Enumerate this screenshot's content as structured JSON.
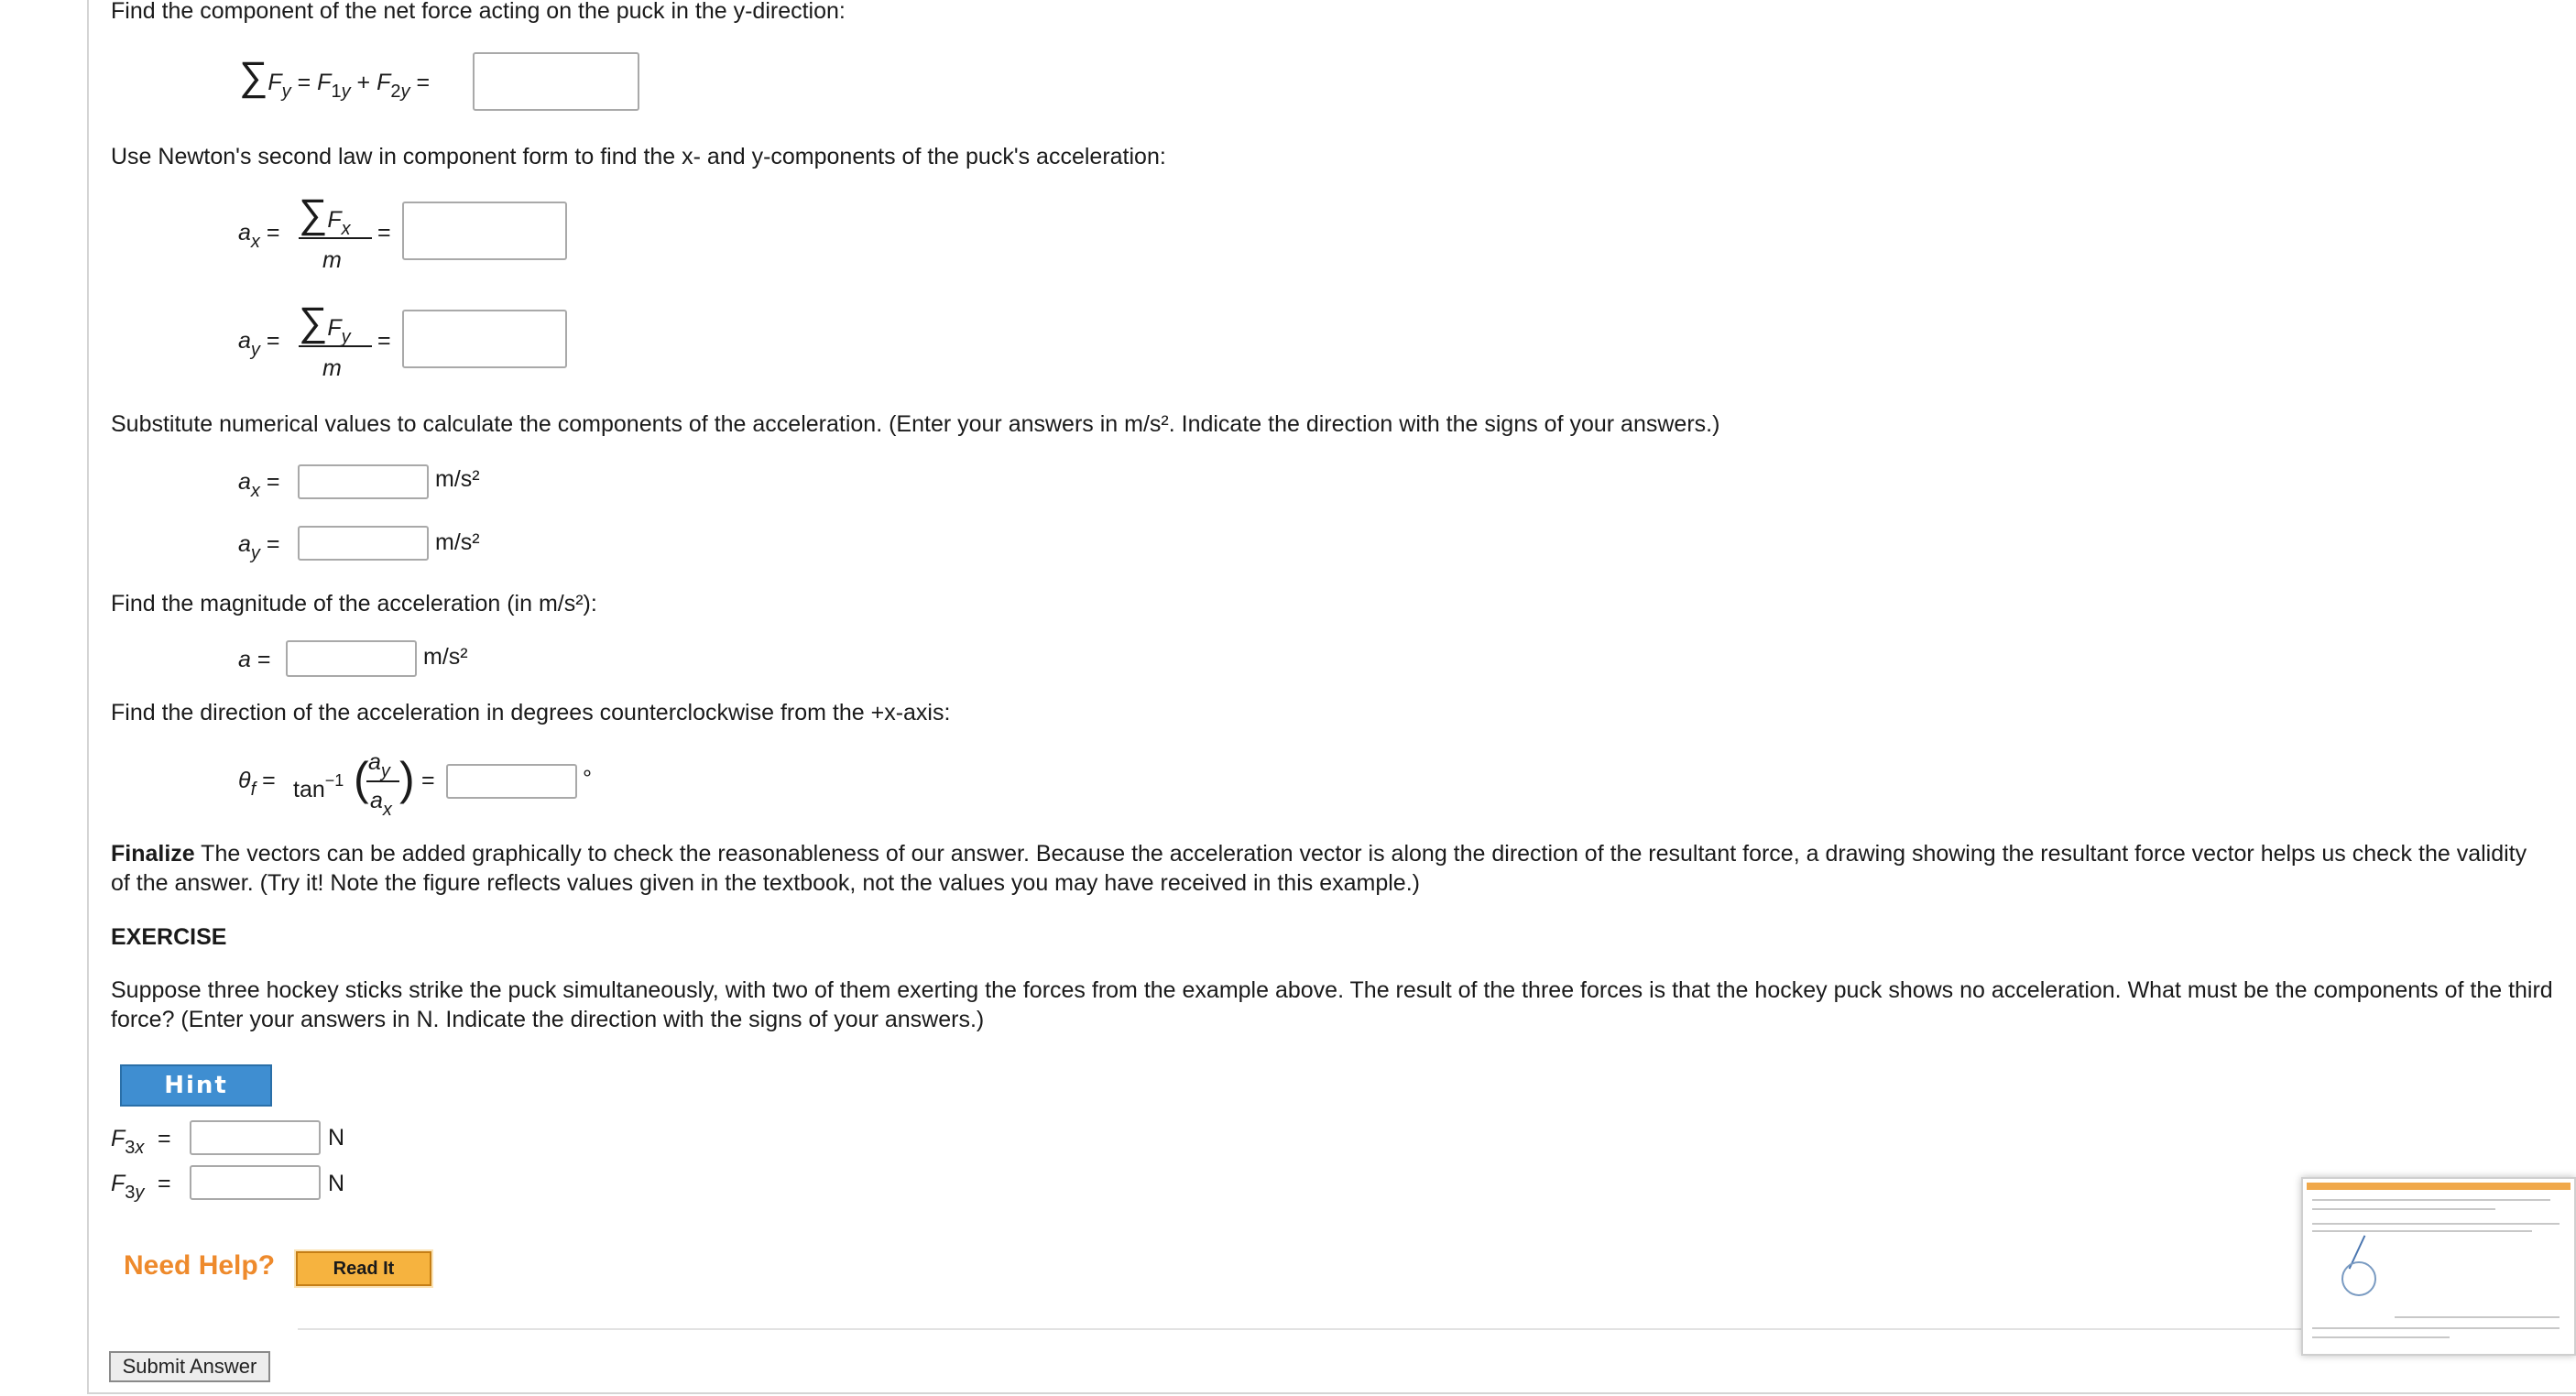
{
  "instructions": {
    "fy_component": "Find the component of the net force acting on the puck in the y-direction:",
    "newton": "Use Newton's second law in component form to find the x- and y-components of the puck's acceleration:",
    "substitute": "Substitute numerical values to calculate the components of the acceleration. (Enter your answers in m/s². Indicate the direction with the signs of your answers.)",
    "magnitude": "Find the magnitude of the acceleration (in m/s²):",
    "direction": "Find the direction of the acceleration in degrees counterclockwise from the +x-axis:"
  },
  "equations": {
    "sum_fy_lhs": "F",
    "eq": "=",
    "plus": "+",
    "m": "m",
    "tan": "tan",
    "tan_exp": "−1"
  },
  "units": {
    "accel": "m/s²",
    "degree": "°",
    "newton": "N"
  },
  "finalize": {
    "label": "Finalize",
    "text": " The vectors can be added graphically to check the reasonableness of our answer. Because the acceleration vector is along the direction of the resultant force, a drawing showing the resultant force vector helps us check the validity of the answer. (Try it! Note the figure reflects values given in the textbook, not the values you may have received in this example.)"
  },
  "exercise": {
    "heading": "EXERCISE",
    "text": "Suppose three hockey sticks strike the puck simultaneously, with two of them exerting the forces from the example above. The result of the three forces is that the hockey puck shows no acceleration. What must be the components of the third force? (Enter your answers in N. Indicate the direction with the signs of your answers.)"
  },
  "buttons": {
    "hint": "Hint",
    "need_help": "Need Help?",
    "read_it": "Read It",
    "submit": "Submit Answer"
  },
  "inputs": {
    "sum_fy": "",
    "ax_symbolic": "",
    "ay_symbolic": "",
    "ax_value": "",
    "ay_value": "",
    "a_value": "",
    "theta_value": "",
    "f3x_value": "",
    "f3y_value": ""
  }
}
